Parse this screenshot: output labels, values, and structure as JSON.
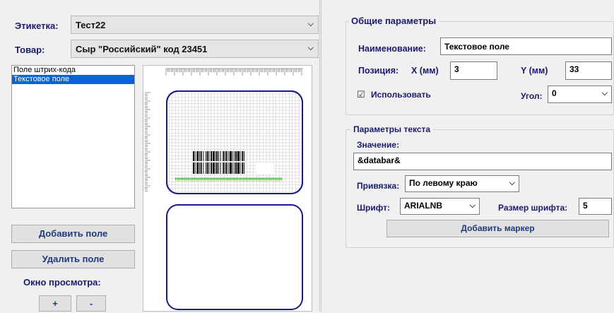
{
  "label_row": {
    "label": "Этикетка:",
    "value": "Тест22"
  },
  "product_row": {
    "label": "Товар:",
    "value": "Сыр \"Российский\" код 23451"
  },
  "fields_list": [
    "Поле штрих-кода",
    "Текстовое поле"
  ],
  "selected_field_index": 1,
  "buttons": {
    "add_field": "Добавить поле",
    "remove_field": "Удалить поле",
    "preview_title": "Окно просмотра:",
    "zoom_in": "+",
    "zoom_out": "-"
  },
  "general": {
    "title": "Общие параметры",
    "name_label": "Наименование:",
    "name_value": "Текстовое поле",
    "pos_label": "Позиция:",
    "x_label": "X (мм)",
    "x_value": "3",
    "y_label": "Y (мм)",
    "y_value": "33",
    "use_label": "Использовать",
    "use_checked": true,
    "angle_label": "Угол:",
    "angle_value": "0"
  },
  "text_params": {
    "title": "Параметры текста",
    "value_label": "Значение:",
    "value": "&databar&",
    "anchor_label": "Привязка:",
    "anchor_value": "По левому краю",
    "font_label": "Шрифт:",
    "font_value": "ARIALNB",
    "font_size_label": "Размер шрифта:",
    "font_size_value": "5",
    "add_marker": "Добавить маркер"
  },
  "colors": {
    "selection": "#0a64d0",
    "label_text": "#1a1a6e",
    "canvas_border": "#1a1a8a",
    "barcode_text": "#2e8b2e"
  }
}
